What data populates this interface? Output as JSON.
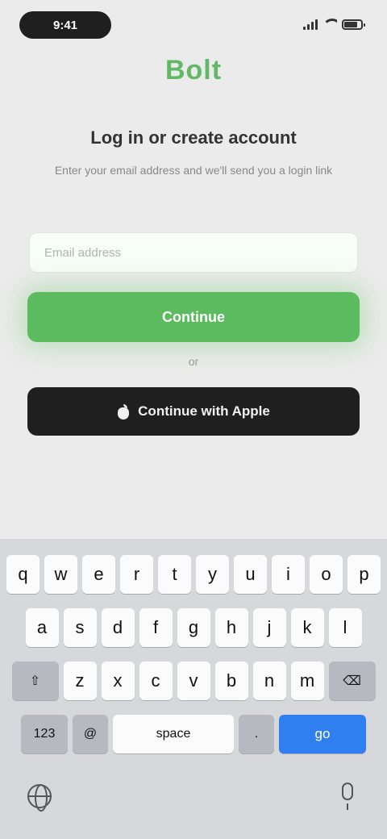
{
  "status": {
    "time": "9:41",
    "icons": [
      "signal-icon",
      "wifi-icon",
      "battery-icon"
    ],
    "battery_level": 0.8
  },
  "brand": {
    "logo": "Bolt",
    "accent": "#5cba5f"
  },
  "header": {
    "title": "Log in or create account",
    "subtitle": "Enter your email address and we'll send you a login link"
  },
  "form": {
    "email_placeholder": "Email address",
    "email_value": "",
    "continue_label": "Continue",
    "or_label": "or",
    "apple_label": "Continue with Apple"
  },
  "keyboard": {
    "row1": [
      "q",
      "w",
      "e",
      "r",
      "t",
      "y",
      "u",
      "i",
      "o",
      "p"
    ],
    "row2": [
      "a",
      "s",
      "d",
      "f",
      "g",
      "h",
      "j",
      "k",
      "l"
    ],
    "row3": [
      "z",
      "x",
      "c",
      "v",
      "b",
      "n",
      "m"
    ],
    "shift_label": "⇧",
    "delete_label": "⌫",
    "numbers_label": "123",
    "at_label": "@",
    "space_label": "space",
    "dot_label": ".",
    "go_label": "go",
    "go_color": "#2f7ff1",
    "bottom_icons": [
      "globe-icon",
      "microphone-icon"
    ]
  }
}
